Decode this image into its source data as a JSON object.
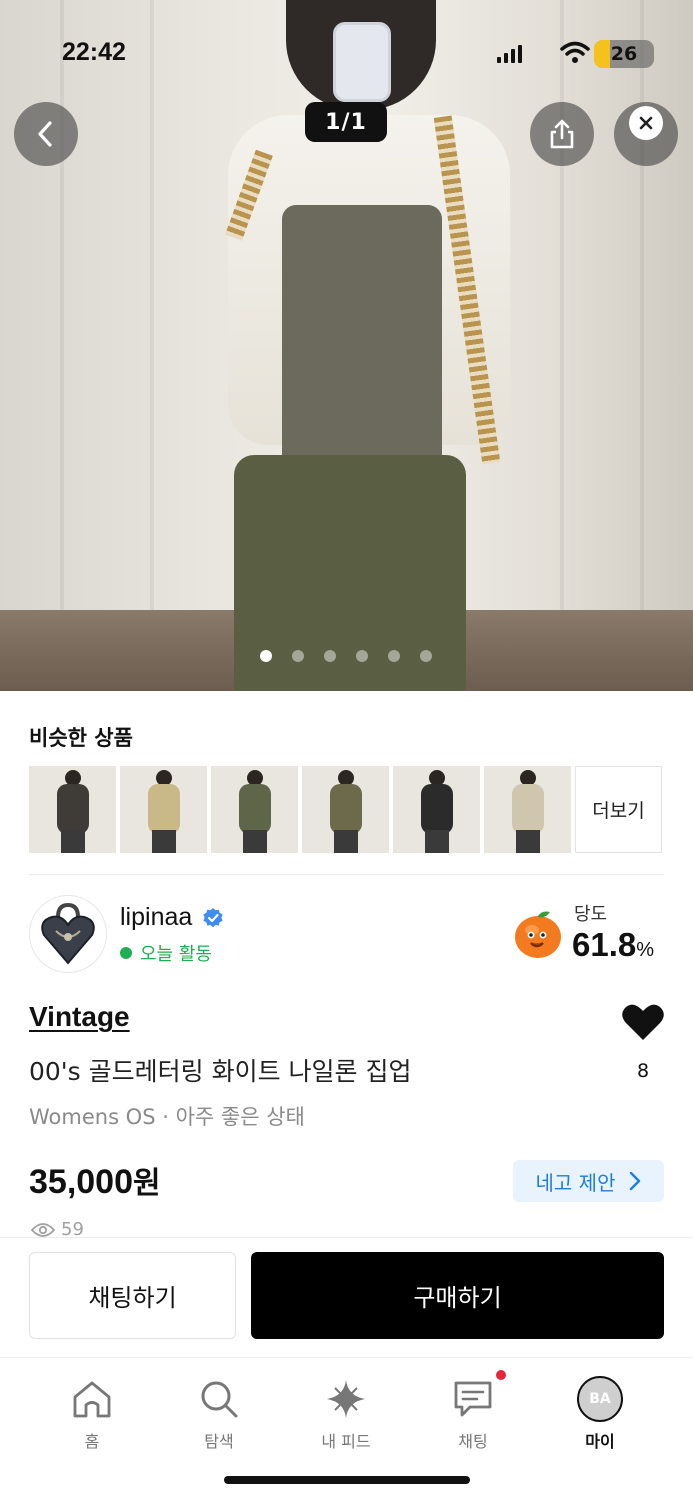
{
  "status_bar": {
    "time": "22:42",
    "battery": "26",
    "battery_level": 0.26
  },
  "hero": {
    "counter": "1/1",
    "dots_total": 6,
    "dots_active": 0
  },
  "similar": {
    "title": "비슷한 상품",
    "more_label": "더보기",
    "items": [
      {
        "jacket_color": "#3f3c37"
      },
      {
        "jacket_color": "#c9b988"
      },
      {
        "jacket_color": "#5e6548"
      },
      {
        "jacket_color": "#6c6a4b"
      },
      {
        "jacket_color": "#2c2b2c"
      },
      {
        "jacket_color": "#cfc6ad"
      }
    ]
  },
  "seller": {
    "name": "lipinaa",
    "activity": "오늘 활동",
    "sweet_label": "당도",
    "sweet_value": "61.8",
    "sweet_unit": "%"
  },
  "product": {
    "brand": "Vintage",
    "title": "00's 골드레터링 화이트 나일론 집업",
    "condition": "Womens OS · 아주 좋은 상태",
    "price": "35,000",
    "price_unit": "원",
    "likes": "8",
    "views": "59",
    "offer_label": "네고 제안"
  },
  "actions": {
    "chat_label": "채팅하기",
    "buy_label": "구매하기"
  },
  "tabbar": {
    "home": "홈",
    "explore": "탐색",
    "feed": "내 피드",
    "chat": "채팅",
    "my": "마이",
    "my_initials": "BA"
  },
  "colors": {
    "accent_blue": "#1b7fe0",
    "activity_green": "#1fae52",
    "notification_red": "#e8243a"
  }
}
